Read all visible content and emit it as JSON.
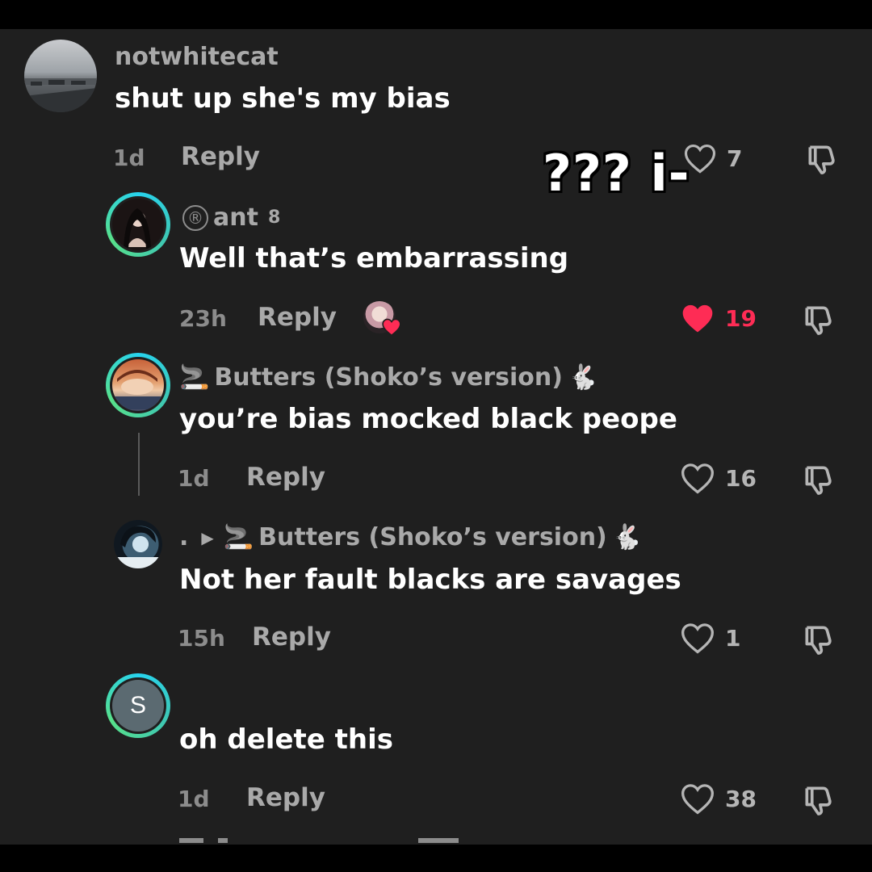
{
  "overlay": {
    "text": "??? i-"
  },
  "comments": [
    {
      "username": "notwhitecat",
      "text": "shut up she's my bias",
      "time": "1d",
      "reply_label": "Reply",
      "likes": "7",
      "liked": false
    },
    {
      "badge": "®",
      "username": "ant",
      "superscript": "8",
      "text": "Well that’s embarrassing",
      "time": "23h",
      "reply_label": "Reply",
      "likes": "19",
      "liked": true,
      "creator_liked": true
    },
    {
      "username_prefix_emoji": "🚬",
      "username": "Butters (Shoko’s version)",
      "username_suffix_emoji": "🐇",
      "text": "you’re bias mocked black peope",
      "time": "1d",
      "reply_label": "Reply",
      "likes": "16",
      "liked": false
    },
    {
      "username": ".",
      "reply_to_prefix_emoji": "🚬",
      "reply_to": "Butters (Shoko’s version)",
      "reply_to_suffix_emoji": "🐇",
      "text": "Not her fault blacks are savages",
      "time": "15h",
      "reply_label": "Reply",
      "likes": "1",
      "liked": false
    },
    {
      "avatar_letter": "S",
      "username": "",
      "text": "oh delete this",
      "time": "1d",
      "reply_label": "Reply",
      "likes": "38",
      "liked": false
    }
  ],
  "colors": {
    "background": "#1f1f1f",
    "liked_red": "#fe2c55",
    "muted": "#a9a9a9",
    "ring_gradient": [
      "#27d3ee",
      "#58e08a"
    ]
  },
  "icons": [
    "heart-outline-icon",
    "heart-filled-icon",
    "thumbs-down-icon",
    "triangle-right-icon"
  ]
}
